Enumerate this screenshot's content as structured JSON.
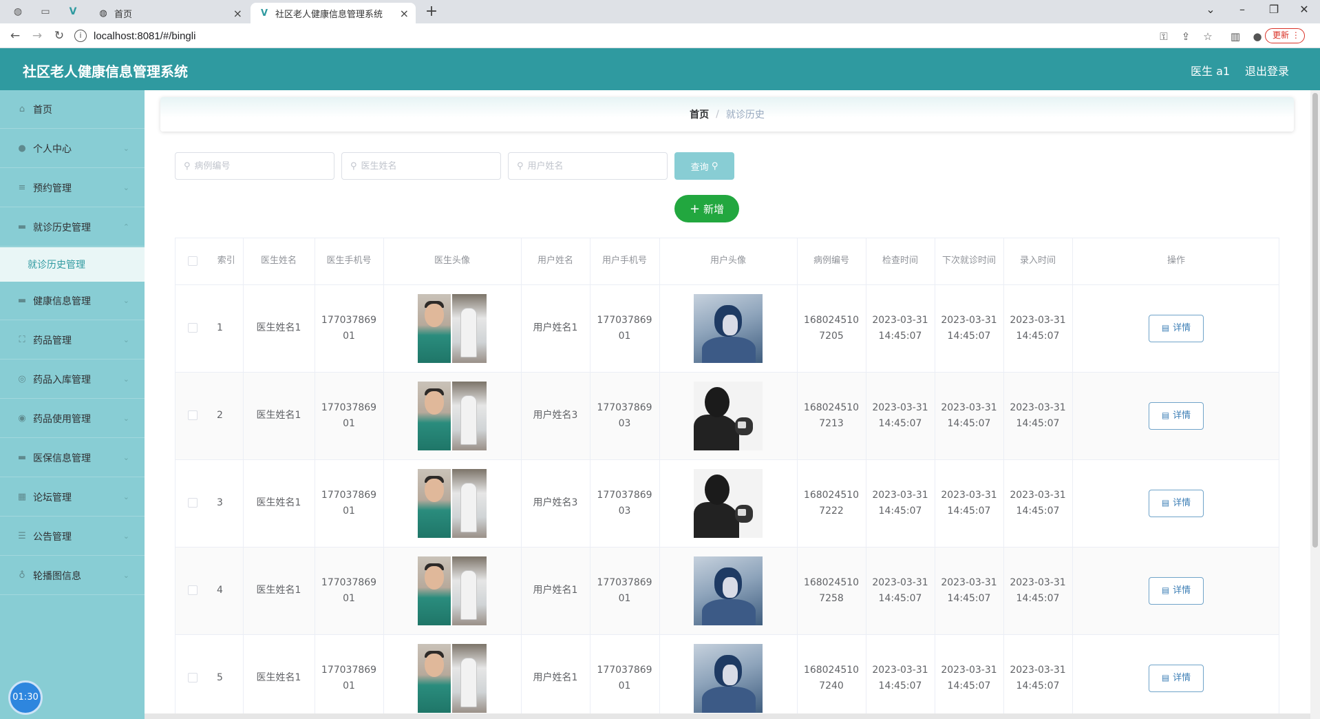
{
  "browser": {
    "tabs": [
      {
        "label": "首页",
        "active": false
      },
      {
        "label": "社区老人健康信息管理系统",
        "active": true
      }
    ],
    "url": "localhost:8081/#/bingli",
    "update_label": "更新"
  },
  "header": {
    "title": "社区老人健康信息管理系统",
    "user": "医生 a1",
    "logout": "退出登录"
  },
  "sidebar": {
    "items": [
      {
        "label": "首页",
        "icon": "home-icon"
      },
      {
        "label": "个人中心",
        "icon": "user-icon"
      },
      {
        "label": "预约管理",
        "icon": "list-icon"
      },
      {
        "label": "就诊历史管理",
        "icon": "folder-icon"
      },
      {
        "label": "健康信息管理",
        "icon": "folder-icon"
      },
      {
        "label": "药品管理",
        "icon": "crop-icon"
      },
      {
        "label": "药品入库管理",
        "icon": "compass-icon"
      },
      {
        "label": "药品使用管理",
        "icon": "circle-icon"
      },
      {
        "label": "医保信息管理",
        "icon": "chat-icon"
      },
      {
        "label": "论坛管理",
        "icon": "grid-icon"
      },
      {
        "label": "公告管理",
        "icon": "sliders-icon"
      },
      {
        "label": "轮播图信息",
        "icon": "mic-icon"
      }
    ],
    "sub_item": "就诊历史管理",
    "clock": "01:30"
  },
  "breadcrumb": {
    "home": "首页",
    "separator": "/",
    "current": "就诊历史"
  },
  "search": {
    "case_placeholder": "病例编号",
    "doctor_placeholder": "医生姓名",
    "user_placeholder": "用户姓名",
    "query_label": "查询",
    "add_label": "新增"
  },
  "table": {
    "headers": [
      "索引",
      "医生姓名",
      "医生手机号",
      "医生头像",
      "用户姓名",
      "用户手机号",
      "用户头像",
      "病例编号",
      "检查时间",
      "下次就诊时间",
      "录入时间",
      "操作"
    ],
    "detail_label": "详情",
    "rows": [
      {
        "index": "1",
        "doctor": "医生姓名1",
        "doctor_phone": "17703786901",
        "user": "用户姓名1",
        "user_phone": "17703786901",
        "user_avatar": "blue",
        "case_no": "1680245107205",
        "check_time": "2023-03-31 14:45:07",
        "next_time": "2023-03-31 14:45:07",
        "entry_time": "2023-03-31 14:45:07"
      },
      {
        "index": "2",
        "doctor": "医生姓名1",
        "doctor_phone": "17703786901",
        "user": "用户姓名3",
        "user_phone": "17703786903",
        "user_avatar": "silhouette",
        "case_no": "1680245107213",
        "check_time": "2023-03-31 14:45:07",
        "next_time": "2023-03-31 14:45:07",
        "entry_time": "2023-03-31 14:45:07"
      },
      {
        "index": "3",
        "doctor": "医生姓名1",
        "doctor_phone": "17703786901",
        "user": "用户姓名3",
        "user_phone": "17703786903",
        "user_avatar": "silhouette",
        "case_no": "1680245107222",
        "check_time": "2023-03-31 14:45:07",
        "next_time": "2023-03-31 14:45:07",
        "entry_time": "2023-03-31 14:45:07"
      },
      {
        "index": "4",
        "doctor": "医生姓名1",
        "doctor_phone": "17703786901",
        "user": "用户姓名1",
        "user_phone": "17703786901",
        "user_avatar": "blue",
        "case_no": "1680245107258",
        "check_time": "2023-03-31 14:45:07",
        "next_time": "2023-03-31 14:45:07",
        "entry_time": "2023-03-31 14:45:07"
      },
      {
        "index": "5",
        "doctor": "医生姓名1",
        "doctor_phone": "17703786901",
        "user": "用户姓名1",
        "user_phone": "17703786901",
        "user_avatar": "blue",
        "case_no": "1680245107240",
        "check_time": "2023-03-31 14:45:07",
        "next_time": "2023-03-31 14:45:07",
        "entry_time": "2023-03-31 14:45:07"
      }
    ]
  },
  "colors": {
    "header": "#2f9aa0",
    "sidebar": "#88cdd4",
    "add_button": "#22a73f"
  }
}
